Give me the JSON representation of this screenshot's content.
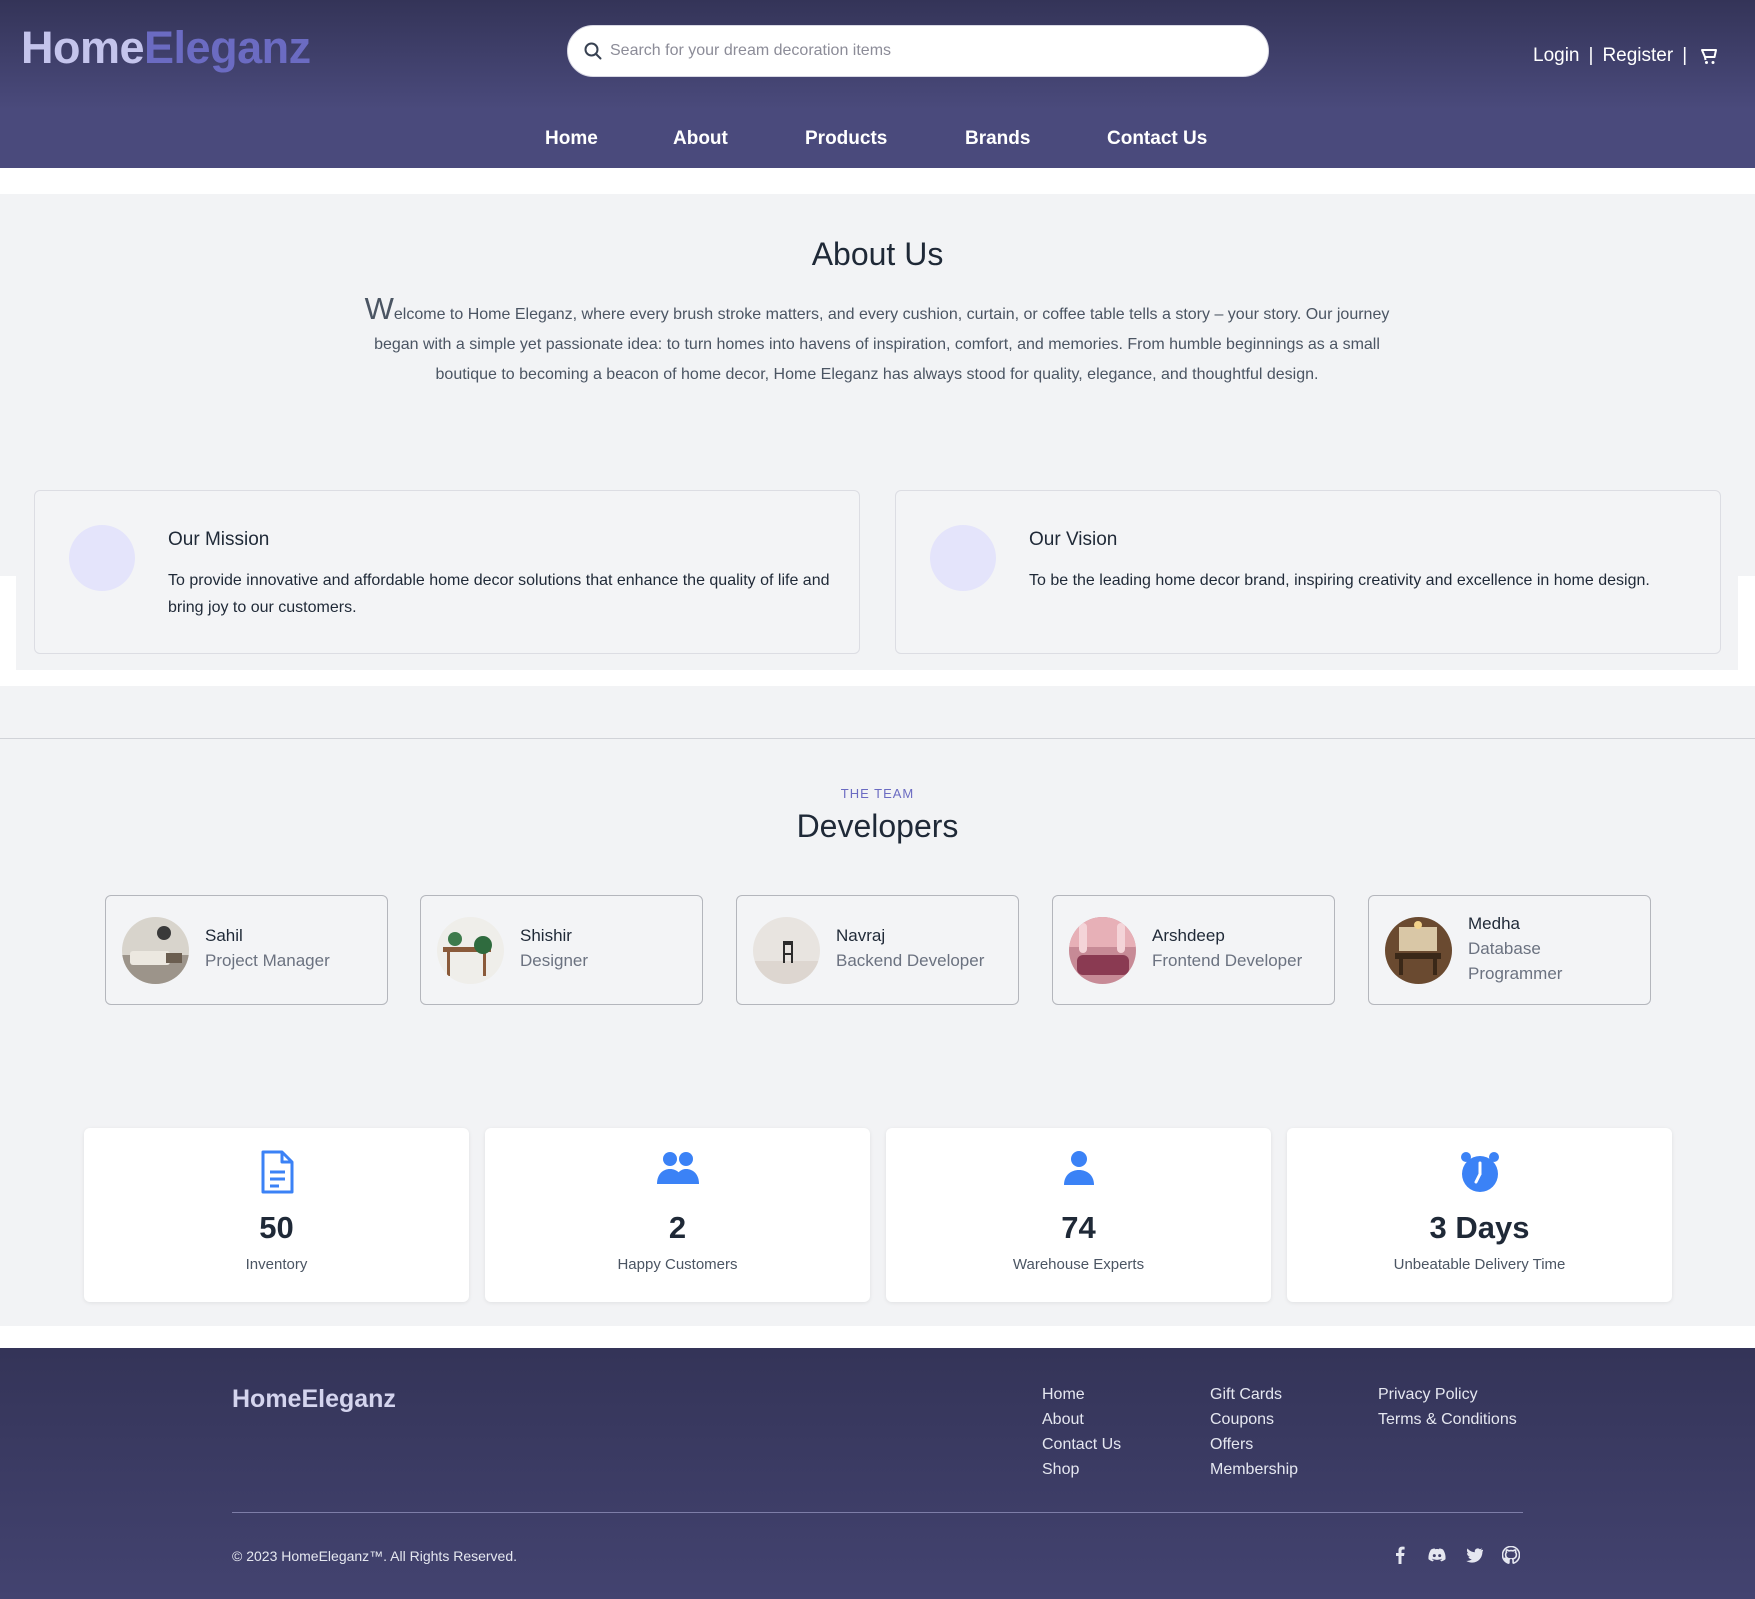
{
  "header": {
    "logo_part1": "Home",
    "logo_part2": "Eleganz",
    "search_placeholder": "Search for your dream decoration items",
    "login": "Login",
    "separator": "|",
    "register": "Register",
    "cart_icon": "cart-icon"
  },
  "nav": {
    "items": [
      "Home",
      "About",
      "Products",
      "Brands",
      "Contact Us"
    ]
  },
  "about": {
    "title": "About Us",
    "dropcap": "W",
    "text_line1": "elcome to Home Eleganz, where every brush stroke matters, and every cushion, curtain, or coffee table tells a story – your story. Our",
    "text_rest": "journey began with a simple yet passionate idea: to turn homes into havens of inspiration, comfort, and memories. From humble beginnings as a small boutique to becoming a beacon of home decor, Home Eleganz has always stood for quality, elegance, and thoughtful design.",
    "mission": {
      "title": "Our Mission",
      "text": "To provide innovative and affordable home decor solutions that enhance the quality of life and bring joy to our customers."
    },
    "vision": {
      "title": "Our Vision",
      "text": "To be the leading home decor brand, inspiring creativity and excellence in home design."
    }
  },
  "team": {
    "eyebrow": "THE TEAM",
    "title": "Developers",
    "members": [
      {
        "name": "Sahil",
        "role": "Project Manager"
      },
      {
        "name": "Shishir",
        "role": "Designer"
      },
      {
        "name": "Navraj",
        "role": "Backend Developer"
      },
      {
        "name": "Arshdeep",
        "role": "Frontend Developer"
      },
      {
        "name": "Medha",
        "role_line1": "Database",
        "role_line2": "Programmer"
      }
    ]
  },
  "stats": [
    {
      "icon": "document-icon",
      "value": "50",
      "label": "Inventory"
    },
    {
      "icon": "users-icon",
      "value": "2",
      "label": "Happy Customers"
    },
    {
      "icon": "user-icon",
      "value": "74",
      "label": "Warehouse Experts"
    },
    {
      "icon": "alarm-clock-icon",
      "value": "3 Days",
      "label": "Unbeatable Delivery Time"
    }
  ],
  "footer": {
    "logo": "HomeEleganz",
    "col1": [
      "Home",
      "About",
      "Contact Us",
      "Shop"
    ],
    "col2": [
      "Gift Cards",
      "Coupons",
      "Offers",
      "Membership"
    ],
    "col3": [
      "Privacy Policy",
      "Terms & Conditions"
    ],
    "copyright": "© 2023 HomeEleganz™. All Rights Reserved.",
    "social_icons": [
      "facebook-icon",
      "discord-icon",
      "twitter-icon",
      "github-icon"
    ]
  },
  "colors": {
    "header_dark": "#343458",
    "header_light": "#4a4a7c",
    "logo_accent": "#6b6bc2",
    "icon_blue": "#3b82f6",
    "section_bg": "#f2f3f5"
  }
}
